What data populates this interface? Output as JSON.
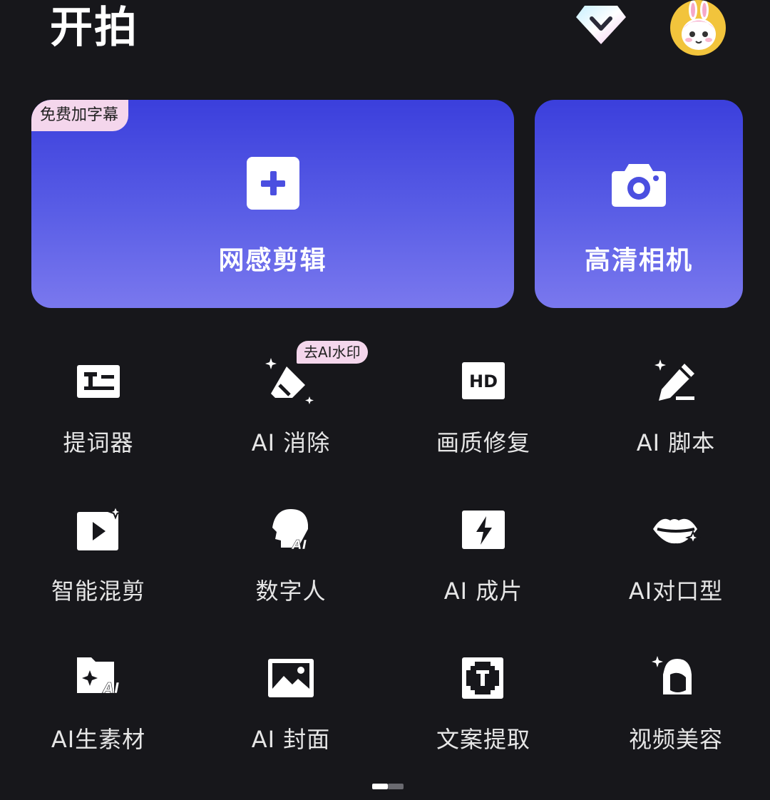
{
  "header": {
    "title": "开拍"
  },
  "hero": {
    "edit": {
      "badge": "免费加字幕",
      "label": "网感剪辑"
    },
    "camera": {
      "label": "高清相机"
    }
  },
  "tools": [
    {
      "label": "提词器",
      "icon": "teleprompter-icon"
    },
    {
      "label": "AI 消除",
      "icon": "eraser-icon",
      "badge": "去AI水印"
    },
    {
      "label": "画质修复",
      "icon": "hd-icon"
    },
    {
      "label": "AI 脚本",
      "icon": "pen-sparkle-icon"
    },
    {
      "label": "智能混剪",
      "icon": "video-sparkle-icon"
    },
    {
      "label": "数字人",
      "icon": "ai-head-icon"
    },
    {
      "label": "AI 成片",
      "icon": "lightning-icon"
    },
    {
      "label": "AI对口型",
      "icon": "lips-icon"
    },
    {
      "label": "AI生素材",
      "icon": "ai-folder-icon"
    },
    {
      "label": "AI 封面",
      "icon": "image-icon"
    },
    {
      "label": "文案提取",
      "icon": "text-extract-icon"
    },
    {
      "label": "视频美容",
      "icon": "face-sparkle-icon"
    }
  ],
  "pager": {
    "pages": 2,
    "current": 1
  },
  "colors": {
    "background": "#17171b",
    "card_gradient_top": "#3b3fdc",
    "card_gradient_bottom": "#7a78ee",
    "badge": "#f4d6ec"
  }
}
